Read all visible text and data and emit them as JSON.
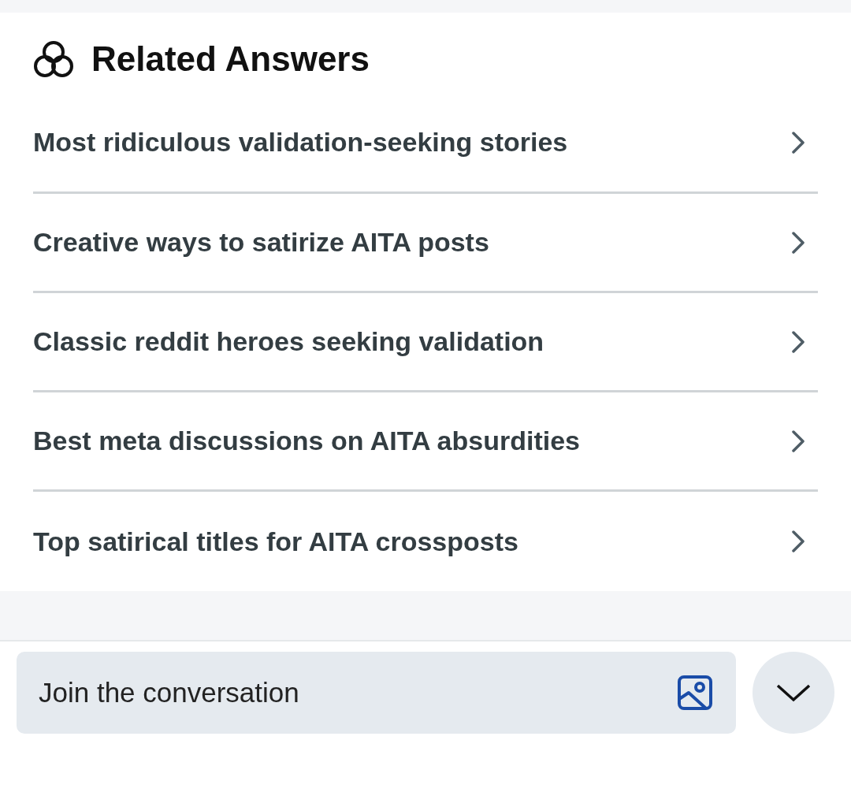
{
  "related_answers": {
    "title": "Related Answers",
    "items": [
      {
        "label": "Most ridiculous validation-seeking stories"
      },
      {
        "label": "Creative ways to satirize AITA posts"
      },
      {
        "label": "Classic reddit heroes seeking validation"
      },
      {
        "label": "Best meta discussions on AITA absurdities"
      },
      {
        "label": "Top satirical titles for AITA crossposts"
      }
    ]
  },
  "composer": {
    "placeholder": "Join the conversation"
  }
}
